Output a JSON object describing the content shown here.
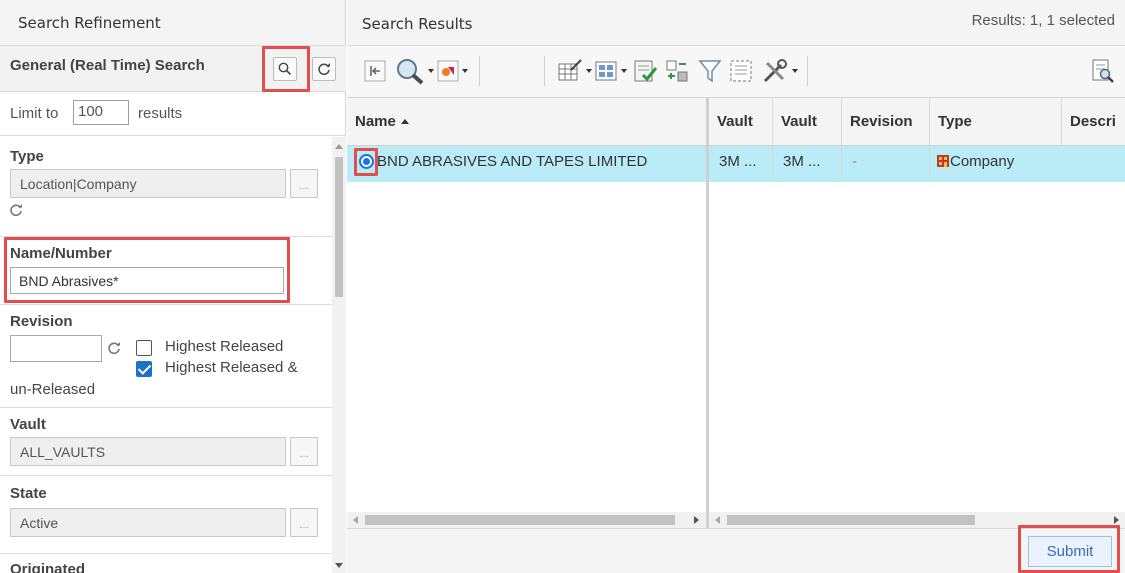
{
  "left_panel": {
    "title": "Search Refinement",
    "general_search_title": "General (Real Time) Search",
    "limit": {
      "prefix": "Limit to",
      "value": "100",
      "suffix": "results"
    },
    "type": {
      "label": "Type",
      "value": "Location|Company",
      "browse_label": "..."
    },
    "name_number": {
      "label": "Name/Number",
      "value": "BND Abrasives*"
    },
    "revision": {
      "label": "Revision",
      "value": "",
      "highest_released_label": "Highest Released",
      "highest_released_checked": false,
      "highest_released_unreleased_label_1": "Highest Released &",
      "highest_released_unreleased_label_2": "un-Released",
      "highest_released_unreleased_checked": true
    },
    "vault": {
      "label": "Vault",
      "value": "ALL_VAULTS",
      "browse_label": "..."
    },
    "state": {
      "label": "State",
      "value": "Active",
      "browse_label": "..."
    },
    "originated": {
      "label": "Originated"
    }
  },
  "right_panel": {
    "title": "Search Results",
    "results_summary": "Results: 1, 1 selected",
    "columns": {
      "name": "Name",
      "vault1": "Vault",
      "vault2": "Vault",
      "revision": "Revision",
      "type": "Type",
      "description": "Descri"
    },
    "rows": [
      {
        "name": "BND ABRASIVES AND TAPES LIMITED",
        "vault1": "3M ...",
        "vault2": "3M ...",
        "revision": "-",
        "type": "Company",
        "selected": true
      }
    ],
    "submit_label": "Submit"
  },
  "colors": {
    "highlight": "#e34d4d",
    "selected_row": "#b9ecf6",
    "accent": "#1a73e8"
  }
}
